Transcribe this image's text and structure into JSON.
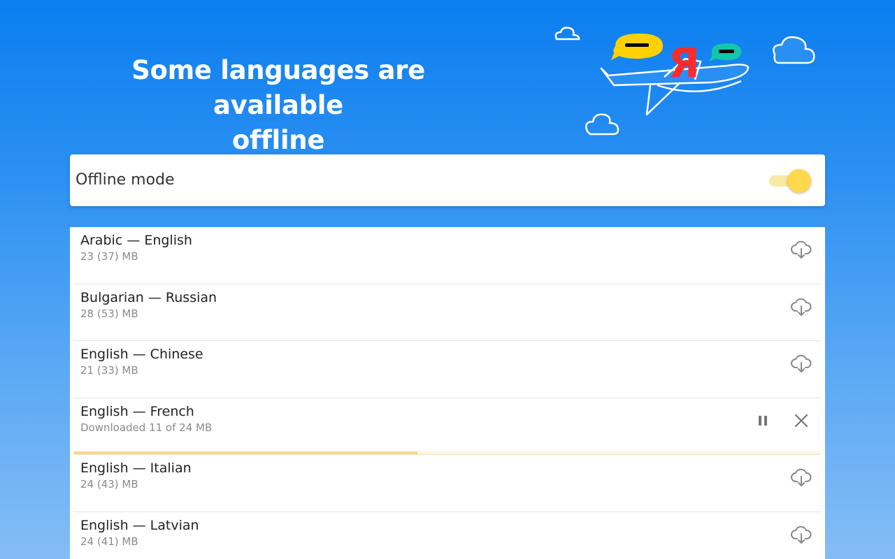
{
  "header": {
    "title_line1": "Some languages are available",
    "title_line2": "offline",
    "logo_letter": "Я"
  },
  "offline_mode": {
    "label": "Offline mode",
    "enabled": true
  },
  "colors": {
    "accent": "#ffd84d",
    "progress": "#f5dc78",
    "bg_top": "#0b7ef0",
    "bg_bottom": "#84bdf6"
  },
  "languages": [
    {
      "name": "Arabic — English",
      "detail": "23 (37) MB",
      "state": "available"
    },
    {
      "name": "Bulgarian — Russian",
      "detail": "28 (53) MB",
      "state": "available"
    },
    {
      "name": "English — Chinese",
      "detail": "21 (33) MB",
      "state": "available"
    },
    {
      "name": "English — French",
      "detail": "Downloaded 11 of 24 MB",
      "state": "downloading",
      "progress": 0.46
    },
    {
      "name": "English — Italian",
      "detail": "24 (43) MB",
      "state": "available"
    },
    {
      "name": "English — Latvian",
      "detail": "24 (41) MB",
      "state": "available"
    }
  ],
  "icons": {
    "available": "cloud-download-icon",
    "pause": "pause-icon",
    "cancel": "close-icon"
  }
}
